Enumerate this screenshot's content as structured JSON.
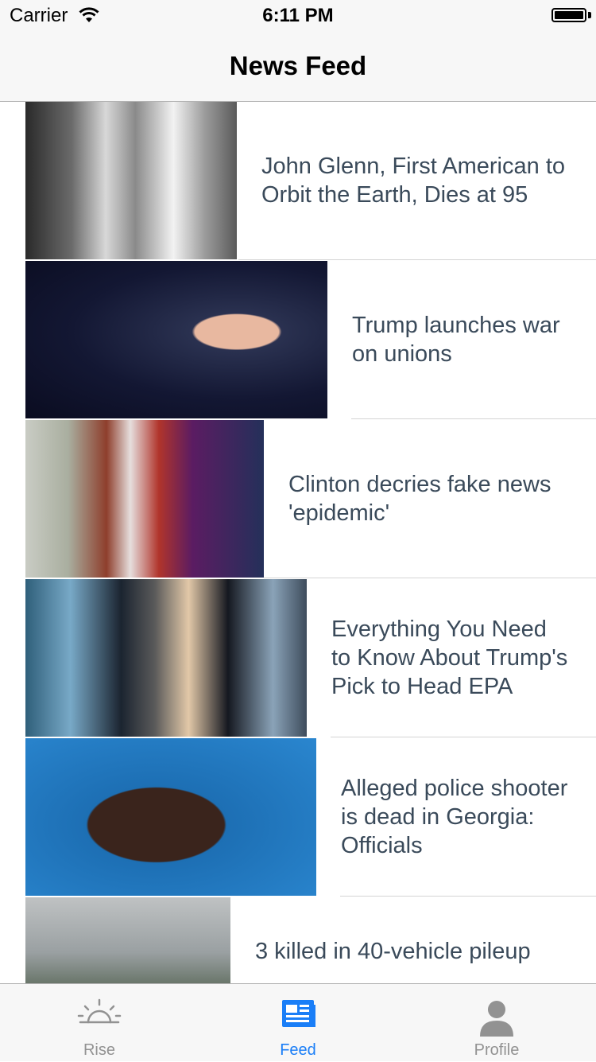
{
  "status_bar": {
    "carrier": "Carrier",
    "time": "6:11 PM",
    "battery_level": 1.0
  },
  "nav": {
    "title": "News Feed"
  },
  "feed": {
    "items": [
      {
        "headline": "John Glenn, First American to Orbit the Earth, Dies at 95",
        "image": "john-glenn-photo"
      },
      {
        "headline": "Trump launches war on unions",
        "image": "trump-speech-photo"
      },
      {
        "headline": "Clinton decries fake news 'epidemic'",
        "image": "clinton-podium-photo"
      },
      {
        "headline": "Everything You Need to Know About Trump's Pick to Head EPA",
        "image": "epa-pick-photo"
      },
      {
        "headline": "Alleged police shooter is dead in Georgia: Officials",
        "image": "suspect-mugshot-photo"
      },
      {
        "headline": "3 killed in 40-vehicle pileup",
        "image": "highway-pileup-photo"
      }
    ]
  },
  "tab_bar": {
    "tabs": [
      {
        "label": "Rise",
        "icon": "sunrise-icon",
        "active": false
      },
      {
        "label": "Feed",
        "icon": "newspaper-icon",
        "active": true
      },
      {
        "label": "Profile",
        "icon": "person-icon",
        "active": false
      }
    ],
    "active_color": "#1a7ef7",
    "inactive_color": "#929292"
  }
}
